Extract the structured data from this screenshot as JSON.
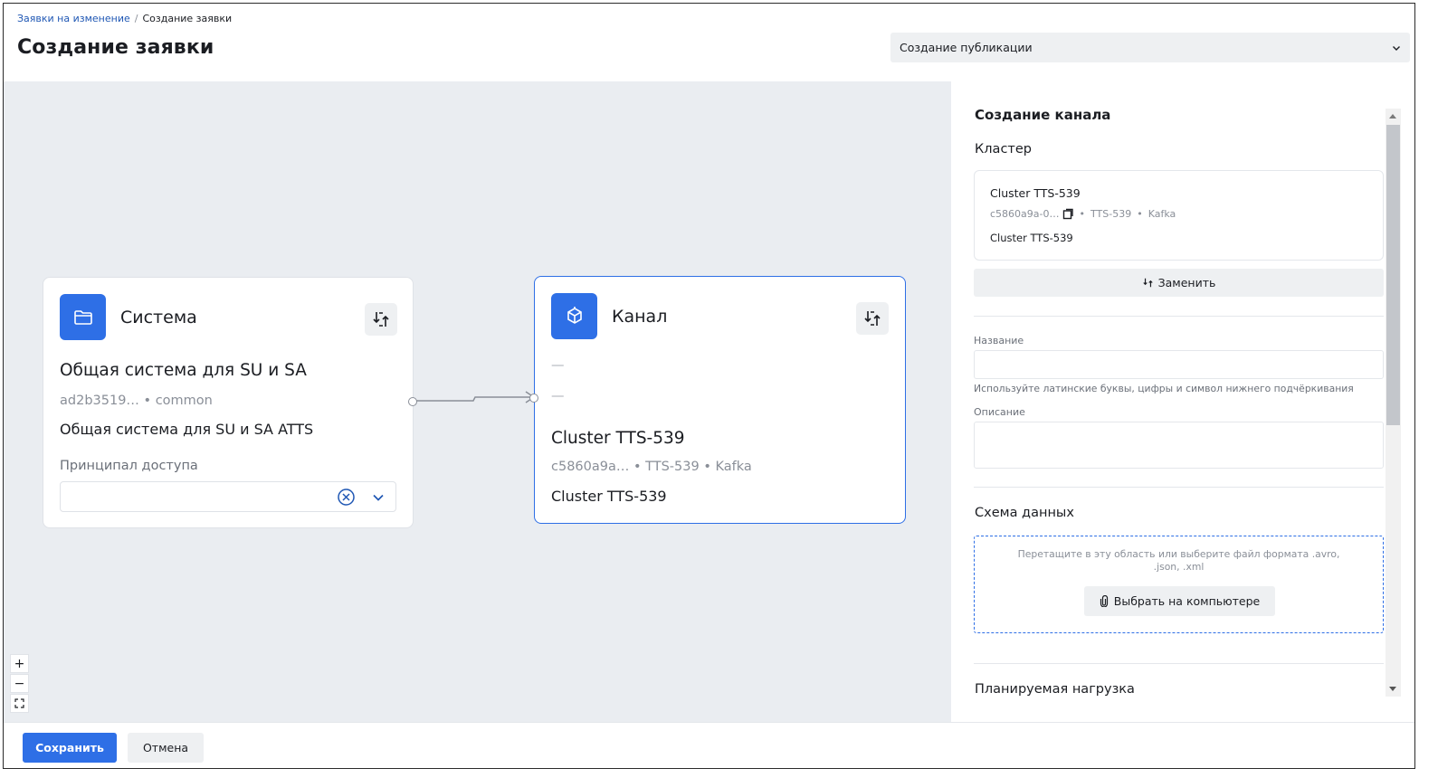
{
  "header": {
    "breadcrumb": {
      "parent": "Заявки на изменение",
      "separator": "/",
      "current": "Создание заявки"
    },
    "title": "Создание заявки",
    "mode_select": {
      "value": "Создание публикации",
      "icon": "chevron-down-icon"
    }
  },
  "canvas": {
    "system_node": {
      "title": "Система",
      "icon": "folder-icon",
      "name": "Общая система для SU и SA",
      "meta": "ad2b3519… • common",
      "description": "Общая система для SU и SA ATTS",
      "principal_label": "Принципал доступа",
      "principal_value": ""
    },
    "channel_node": {
      "title": "Канал",
      "icon": "cube-icon",
      "dash1": "—",
      "dash2": "—",
      "name": "Cluster TTS-539",
      "meta": "c5860a9a… • TTS-539 • Kafka",
      "description": "Cluster TTS-539"
    },
    "zoom": {
      "zoom_in": "+",
      "zoom_out": "−",
      "fit": "⛶"
    }
  },
  "panel": {
    "title": "Создание канала",
    "cluster_label": "Кластер",
    "cluster_card": {
      "name": "Cluster TTS-539",
      "id": "c5860a9a-0…",
      "code": "TTS-539",
      "type": "Kafka",
      "description": "Cluster TTS-539"
    },
    "replace_button": "Заменить",
    "name_field": {
      "label": "Название",
      "value": "",
      "hint": "Используйте латинские буквы, цифры и символ нижнего подчёркивания"
    },
    "description_field": {
      "label": "Описание",
      "value": ""
    },
    "schema_label": "Схема данных",
    "dropzone": {
      "text": "Перетащите в эту область или выберите файл формата .avro, .json, .xml",
      "button": "Выбрать на компьютере"
    },
    "load_label": "Планируемая нагрузка"
  },
  "footer": {
    "save": "Сохранить",
    "cancel": "Отмена"
  },
  "colors": {
    "accent": "#2e6fe6",
    "canvas_bg": "#eaedf1",
    "link": "#1f57b4"
  }
}
